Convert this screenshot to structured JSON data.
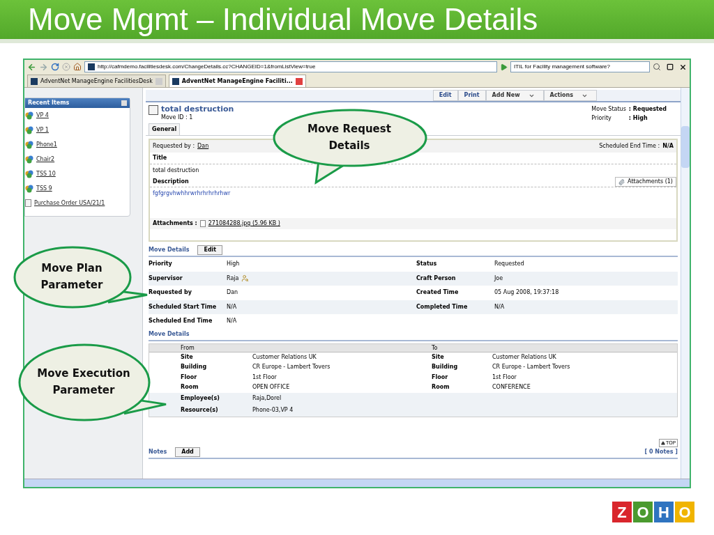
{
  "slide": {
    "title": "Move Mgmt – Individual Move Details"
  },
  "browser": {
    "url": "http://cafmdemo.facilitiesdesk.com/ChangeDetails.cc?CHANGEID=1&fromListView=true",
    "search": "ITIL for Facility management software?",
    "tabs": [
      {
        "label": "AdventNet ManageEngine FacilitiesDesk",
        "selected": false
      },
      {
        "label": "AdventNet ManageEngine Faciliti...",
        "selected": true
      }
    ]
  },
  "actions": [
    {
      "label": "Edit",
      "kind": "button"
    },
    {
      "label": "Print",
      "kind": "button"
    },
    {
      "label": "Add New",
      "kind": "menu"
    },
    {
      "label": "Actions",
      "kind": "menu"
    }
  ],
  "sidebar": {
    "title": "Recent Items",
    "items": [
      {
        "label": "VP 4",
        "kind": "asset"
      },
      {
        "label": "VP 1",
        "kind": "asset"
      },
      {
        "label": "Phone1",
        "kind": "asset"
      },
      {
        "label": "Chair2",
        "kind": "asset"
      },
      {
        "label": "TSS 10",
        "kind": "asset"
      },
      {
        "label": "TSS 9",
        "kind": "asset"
      },
      {
        "label": "Purchase Order USA/21/1",
        "kind": "order"
      }
    ]
  },
  "request": {
    "title": "total destruction",
    "move_id": "Move ID : 1",
    "status_label": "Move Status",
    "status": ": Requested",
    "priority_label": "Priority",
    "priority": ": High",
    "tab": "General",
    "requested_by_label": "Requested by :",
    "requested_by": "Dan",
    "scheduled_end_label": "Scheduled End Time :",
    "scheduled_end": "N/A",
    "title_label": "Title",
    "title_value": "total destruction",
    "description_label": "Description",
    "description": "fgfgrgvhwhhrwrhrhrhrhrhwr",
    "attachments_button": "Attachments (1)",
    "attachments_label": "Attachments :",
    "attachment": "271084288.jpg (5.96 KB )"
  },
  "plan": {
    "heading": "Move Details",
    "edit": "Edit",
    "rows": [
      {
        "label": "Priority",
        "value": "High",
        "kind": "text",
        "label2": "Status",
        "value2": "Requested"
      },
      {
        "label": "Supervisor",
        "value": "Raja",
        "kind": "person",
        "label2": "Craft Person",
        "value2": "Joe"
      },
      {
        "label": "Requested by",
        "value": "Dan",
        "kind": "text",
        "label2": "Created Time",
        "value2": "05 Aug 2008, 19:37:18"
      },
      {
        "label": "Scheduled Start Time",
        "value": "N/A",
        "kind": "text",
        "label2": "Completed Time",
        "value2": "N/A"
      },
      {
        "label": "Scheduled End Time",
        "value": "N/A",
        "kind": "text"
      }
    ]
  },
  "execution": {
    "heading": "Move Details",
    "from": "From",
    "to": "To",
    "rows": [
      {
        "label": "Site",
        "from": "Customer Relations UK",
        "label2": "Site",
        "to": "Customer Relations UK",
        "kind": "location"
      },
      {
        "label": "Building",
        "from": "CR Europe - Lambert Tovers",
        "label2": "Building",
        "to": "CR Europe - Lambert Tovers",
        "kind": "location"
      },
      {
        "label": "Floor",
        "from": "1st Floor",
        "label2": "Floor",
        "to": "1st Floor",
        "kind": "location"
      },
      {
        "label": "Room",
        "from": "OPEN OFFICE",
        "label2": "Room",
        "to": "CONFERENCE",
        "kind": "location"
      },
      {
        "label": "Employee(s)",
        "from": "Raja,Dorel",
        "kind": "assignment"
      },
      {
        "label": "Resource(s)",
        "from": "Phone-03,VP 4",
        "kind": "assignment"
      }
    ]
  },
  "notes": {
    "label": "Notes",
    "add": "Add",
    "top": "TOP",
    "count": "[ 0 Notes ]"
  },
  "callouts": [
    {
      "text": "Move Request Details",
      "kind": "down"
    },
    {
      "text": "Move Plan Parameter",
      "kind": "right"
    },
    {
      "text": "Move Execution Parameter",
      "kind": "right"
    }
  ],
  "logo": {
    "letters": [
      {
        "text": "Z",
        "color": "#d9262c"
      },
      {
        "text": "O",
        "color": "#4a9a2f"
      },
      {
        "text": "H",
        "color": "#2f74c0"
      },
      {
        "text": "O",
        "color": "#f0b400"
      }
    ]
  }
}
